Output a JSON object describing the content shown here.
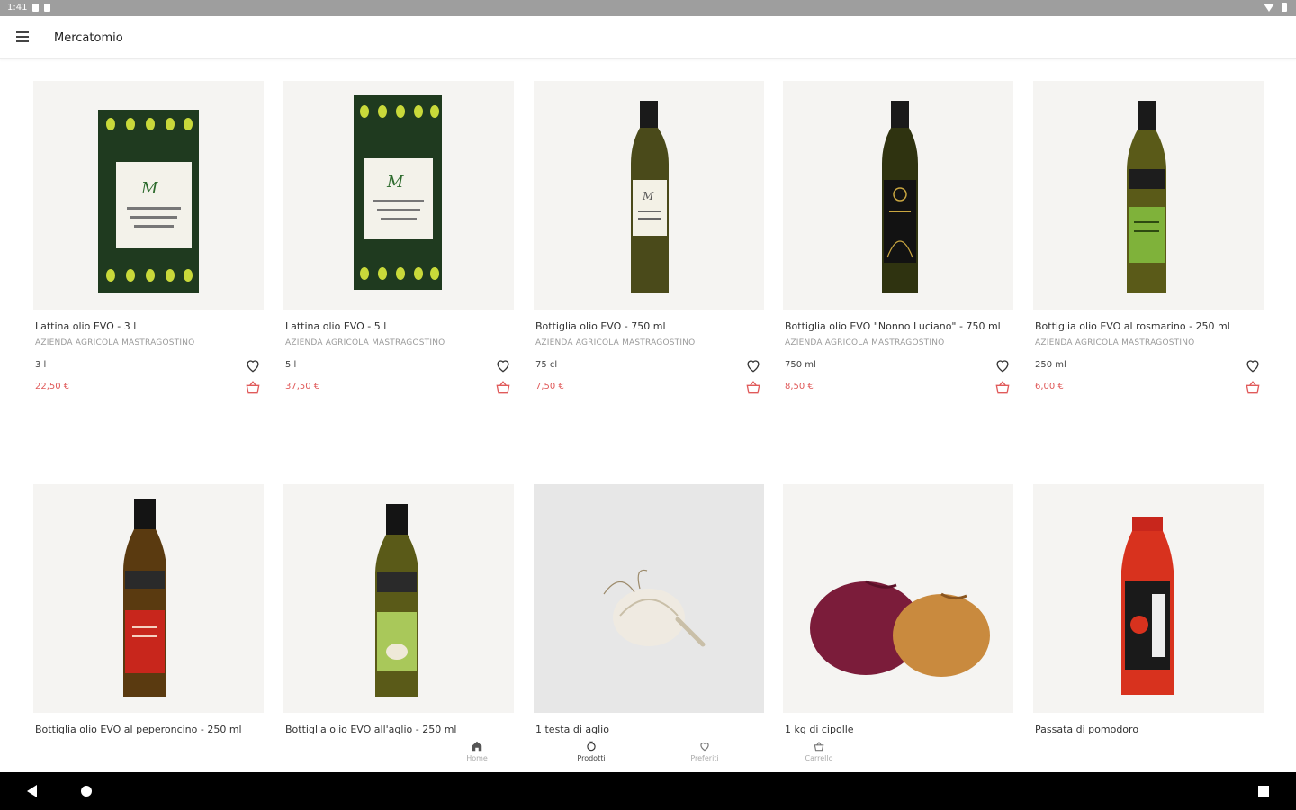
{
  "status_bar": {
    "time": "1:41"
  },
  "app_bar": {
    "title": "Mercatomio"
  },
  "products": [
    {
      "name": "Lattina olio EVO - 3 l",
      "brand": "AZIENDA AGRICOLA MASTRAGOSTINO",
      "size": "3 l",
      "price": "22,50 €",
      "image": "tin-green"
    },
    {
      "name": "Lattina olio EVO - 5 l",
      "brand": "AZIENDA AGRICOLA MASTRAGOSTINO",
      "size": "5 l",
      "price": "37,50 €",
      "image": "tin-green-tall"
    },
    {
      "name": "Bottiglia olio EVO - 750 ml",
      "brand": "AZIENDA AGRICOLA MASTRAGOSTINO",
      "size": "75 cl",
      "price": "7,50 €",
      "image": "bottle-white-label"
    },
    {
      "name": "Bottiglia olio EVO \"Nonno Luciano\" - 750 ml",
      "brand": "AZIENDA AGRICOLA MASTRAGOSTINO",
      "size": "750 ml",
      "price": "8,50 €",
      "image": "bottle-black-label"
    },
    {
      "name": "Bottiglia olio EVO al rosmarino - 250 ml",
      "brand": "AZIENDA AGRICOLA MASTRAGOSTINO",
      "size": "250 ml",
      "price": "6,00 €",
      "image": "bottle-green-label"
    },
    {
      "name": "Bottiglia olio EVO al peperoncino - 250 ml",
      "brand": "",
      "size": "",
      "price": "",
      "image": "bottle-red-label"
    },
    {
      "name": "Bottiglia olio EVO all'aglio - 250 ml",
      "brand": "",
      "size": "",
      "price": "",
      "image": "bottle-garlic-label"
    },
    {
      "name": "1 testa di aglio",
      "brand": "",
      "size": "",
      "price": "",
      "image": "garlic"
    },
    {
      "name": "1 kg di cipolle",
      "brand": "",
      "size": "",
      "price": "",
      "image": "onions"
    },
    {
      "name": "Passata di pomodoro",
      "brand": "",
      "size": "",
      "price": "",
      "image": "tomato-passata"
    }
  ],
  "bottom_nav": {
    "items": [
      {
        "label": "Home",
        "icon": "home-icon"
      },
      {
        "label": "Prodotti",
        "icon": "products-icon"
      },
      {
        "label": "Preferiti",
        "icon": "heart-icon"
      },
      {
        "label": "Carrello",
        "icon": "cart-icon"
      }
    ],
    "active": "Prodotti"
  },
  "colors": {
    "price": "#e05a5a",
    "accent": "#e05a5a",
    "status_bar": "#9e9e9e"
  }
}
